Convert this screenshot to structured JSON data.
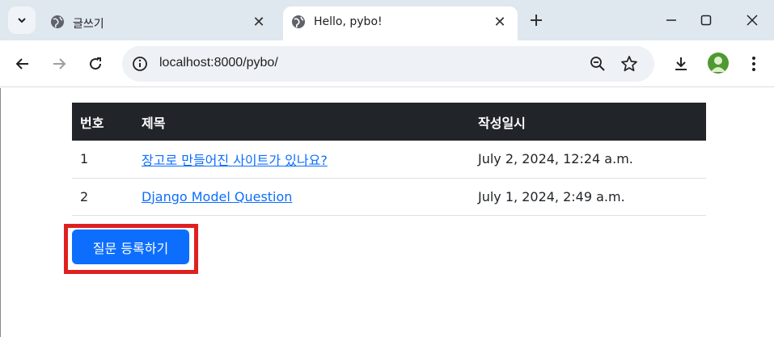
{
  "browser": {
    "tabs": [
      {
        "title": "글쓰기",
        "active": false
      },
      {
        "title": "Hello, pybo!",
        "active": true
      }
    ],
    "address": "localhost:8000/pybo/"
  },
  "colors": {
    "accent": "#0d6efd",
    "header_bg": "#212529",
    "highlight": "#e01f1f"
  },
  "table": {
    "headers": [
      "번호",
      "제목",
      "작성일시"
    ],
    "rows": [
      {
        "num": "1",
        "title": "장고로 만들어진 사이트가 있나요?",
        "date": "July 2, 2024, 12:24 a.m."
      },
      {
        "num": "2",
        "title": "Django Model Question",
        "date": "July 1, 2024, 2:49 a.m."
      }
    ]
  },
  "actions": {
    "register_question": "질문 등록하기"
  }
}
